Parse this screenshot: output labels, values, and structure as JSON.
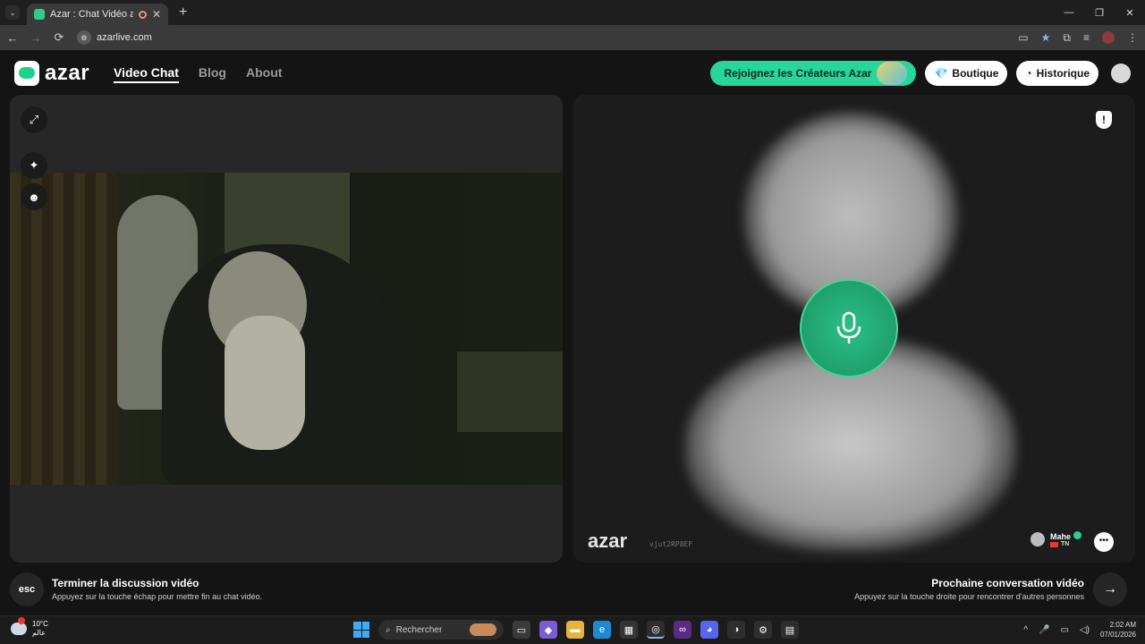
{
  "browser": {
    "tab_title": "Azar : Chat Vidéo avec de n",
    "tab_close": "✕",
    "new_tab": "+",
    "window_buttons": [
      "—",
      "❐",
      "✕"
    ],
    "nav_back": "←",
    "nav_forward": "→",
    "nav_reload": "⟳",
    "url": "azarlive.com"
  },
  "header": {
    "logo_text": "azar",
    "nav": [
      {
        "label": "Video Chat",
        "active": true
      },
      {
        "label": "Blog",
        "active": false
      },
      {
        "label": "About",
        "active": false
      }
    ],
    "creators_label": "Rejoignez les Créateurs Azar",
    "boutique_label": "Boutique",
    "boutique_icon": "💎",
    "history_label": "Historique",
    "history_icon": "◔"
  },
  "left_panel": {
    "tools": [
      {
        "name": "expand-icon",
        "glyph": "⤢"
      },
      {
        "name": "sparkle-effects-icon",
        "glyph": "✦"
      },
      {
        "name": "face-filter-icon",
        "glyph": "☻"
      }
    ]
  },
  "right_panel": {
    "report_glyph": "!",
    "watermark": "azar",
    "watermark_id": "vjut2RP8EF",
    "peer_name": "Mahe",
    "peer_country": "TN",
    "chat_glyph": "•••"
  },
  "bottom": {
    "esc_label": "esc",
    "end_title": "Terminer la discussion vidéo",
    "end_sub": "Appuyez sur la touche échap pour mettre fin au chat vidéo.",
    "next_title": "Prochaine conversation vidéo",
    "next_sub": "Appuyez sur la touche droite pour rencontrer d'autres personnes",
    "next_glyph": "→"
  },
  "taskbar": {
    "temperature": "10°C",
    "weather_sub": "عالم",
    "search_label": "Rechercher",
    "time": "2:02 AM",
    "date": "07/01/2026"
  },
  "colors": {
    "accent_green": "#26d69a",
    "mic_green": "#1fa06f"
  }
}
